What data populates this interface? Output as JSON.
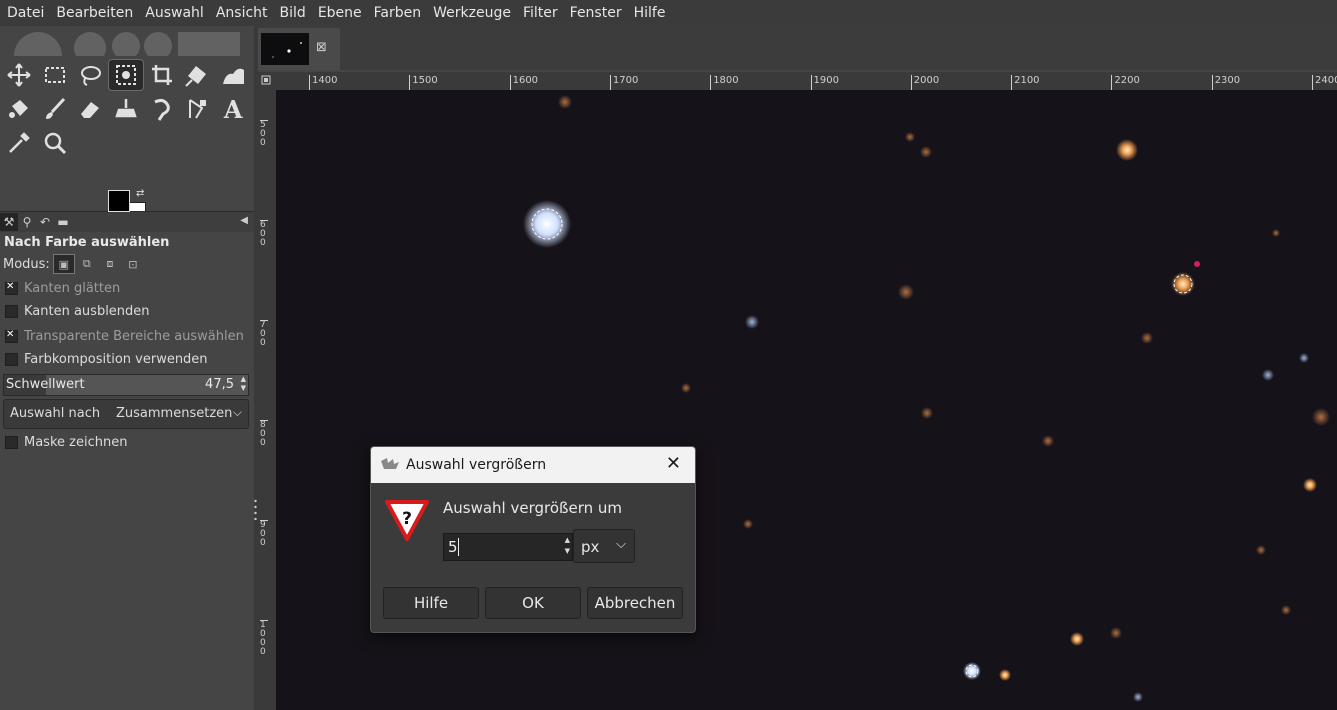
{
  "menubar": [
    "Datei",
    "Bearbeiten",
    "Auswahl",
    "Ansicht",
    "Bild",
    "Ebene",
    "Farben",
    "Werkzeuge",
    "Filter",
    "Fenster",
    "Hilfe"
  ],
  "tools": {
    "rows": [
      [
        {
          "name": "move-icon"
        },
        {
          "name": "rect-select-icon"
        },
        {
          "name": "lasso-icon"
        },
        {
          "name": "fuzzy-select-icon",
          "active": true
        },
        {
          "name": "crop-icon"
        },
        {
          "name": "transform-icon"
        },
        {
          "name": "warp-icon"
        }
      ],
      [
        {
          "name": "bucket-fill-icon"
        },
        {
          "name": "paintbrush-icon"
        },
        {
          "name": "eraser-icon"
        },
        {
          "name": "clone-icon"
        },
        {
          "name": "smudge-icon"
        },
        {
          "name": "paths-icon"
        },
        {
          "name": "text-icon"
        }
      ],
      [
        {
          "name": "color-picker-icon"
        },
        {
          "name": "zoom-icon"
        }
      ]
    ],
    "text_tool_glyph": "A"
  },
  "colors": {
    "foreground": "#000000",
    "background": "#ffffff",
    "accent": "#3a3a3a"
  },
  "options": {
    "title": "Nach Farbe auswählen",
    "mode_label": "Modus:",
    "checkboxes": [
      {
        "label": "Kanten glätten",
        "checked": true,
        "dim": true
      },
      {
        "label": "Kanten ausblenden",
        "checked": false,
        "dim": false
      },
      {
        "label": "Transparente Bereiche auswählen",
        "checked": true,
        "dim": true
      },
      {
        "label": "Farbkomposition verwenden",
        "checked": false,
        "dim": false
      }
    ],
    "threshold": {
      "label": "Schwellwert",
      "value": "47,5"
    },
    "select_by": {
      "label": "Auswahl nach",
      "value": "Zusammensetzen"
    },
    "draw_mask": {
      "label": "Maske zeichnen",
      "checked": false
    }
  },
  "ruler": {
    "h_labels": [
      "1400",
      "1500",
      "1600",
      "1700",
      "1800",
      "1900",
      "2000",
      "2100",
      "2200",
      "2300",
      "2400"
    ],
    "v_labels": [
      "500",
      "600",
      "700",
      "800",
      "900",
      "1000"
    ]
  },
  "dialog": {
    "title": "Auswahl vergrößern",
    "label": "Auswahl vergrößern um",
    "value": "5",
    "unit": "px",
    "buttons": {
      "help": "Hilfe",
      "ok": "OK",
      "cancel": "Abbrechen"
    }
  }
}
